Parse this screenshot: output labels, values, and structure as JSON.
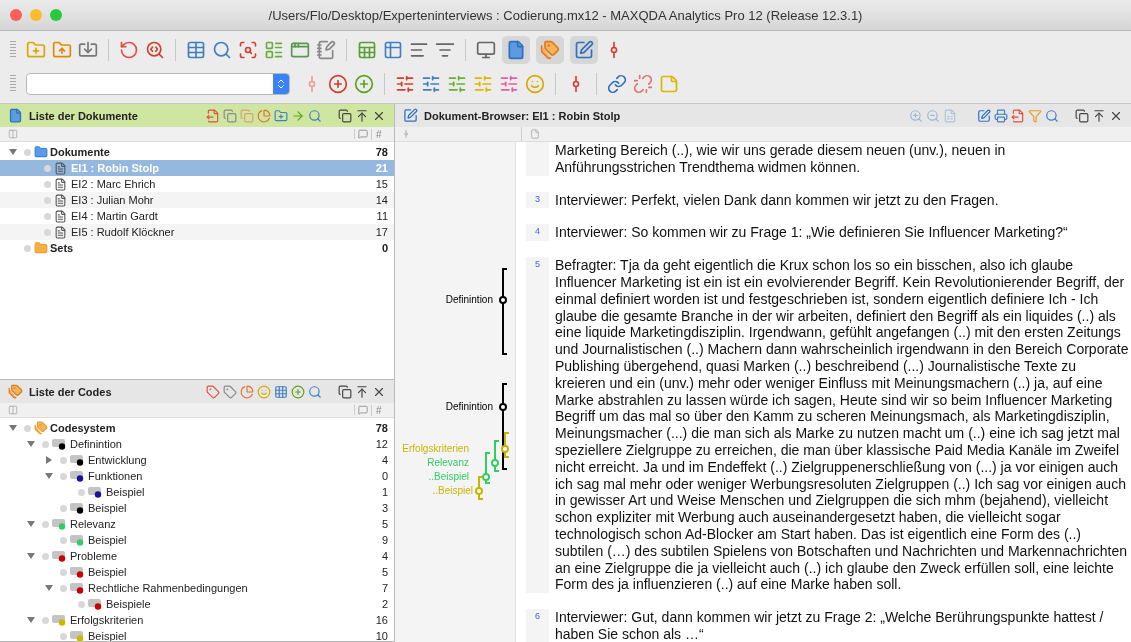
{
  "window": {
    "title": "/Users/Flo/Desktop/Experteninterviews : Codierung.mx12 - MAXQDA Analytics Pro 12  (Release 12.3.1)"
  },
  "toolbar": {
    "view_toggles": [
      {
        "on": true
      },
      {
        "on": true
      },
      {
        "on": true
      }
    ]
  },
  "documents_panel": {
    "title": "Liste der Dokumente",
    "count_column": "#",
    "tree": [
      {
        "label": "Dokumente",
        "count": "78",
        "kind": "folder",
        "expanded": true,
        "selected": false,
        "children": [
          {
            "label": "EI1 : Robin Stolp",
            "count": "21",
            "kind": "doc",
            "selected": true
          },
          {
            "label": "EI2 : Marc Ehrich",
            "count": "15",
            "kind": "doc",
            "selected": false
          },
          {
            "label": "EI3 : Julian Mohr",
            "count": "14",
            "kind": "doc",
            "selected": false
          },
          {
            "label": "EI4 : Martin Gardt",
            "count": "11",
            "kind": "doc",
            "selected": false
          },
          {
            "label": "EI5 : Rudolf Klöckner",
            "count": "17",
            "kind": "doc",
            "selected": false
          }
        ]
      },
      {
        "label": "Sets",
        "count": "0",
        "kind": "set",
        "selected": false
      }
    ]
  },
  "codes_panel": {
    "title": "Liste der Codes",
    "count_column": "#",
    "tree": [
      {
        "label": "Codesystem",
        "count": "78",
        "kind": "root",
        "expanded": true,
        "children": [
          {
            "label": "Definintion",
            "count": "12",
            "color": "#000000",
            "expanded": true,
            "children": [
              {
                "label": "Entwicklung",
                "count": "4",
                "color": "#000000",
                "expanded": false
              },
              {
                "label": "Funktionen",
                "count": "0",
                "color": "#1a0f9e",
                "expanded": true,
                "children": [
                  {
                    "label": "Beispiel",
                    "count": "1",
                    "color": "#1a0f9e"
                  }
                ]
              },
              {
                "label": "Beispiel",
                "count": "3",
                "color": "#000000"
              }
            ]
          },
          {
            "label": "Relevanz",
            "count": "5",
            "color": "#33cc66",
            "expanded": true,
            "children": [
              {
                "label": "Beispiel",
                "count": "9",
                "color": "#33cc66"
              }
            ]
          },
          {
            "label": "Probleme",
            "count": "4",
            "color": "#cc0000",
            "expanded": true,
            "children": [
              {
                "label": "Beispiel",
                "count": "5",
                "color": "#cc0000"
              },
              {
                "label": "Rechtliche Rahmenbedingungen",
                "count": "7",
                "color": "#cc0000",
                "expanded": true,
                "children": [
                  {
                    "label": "Beispiele",
                    "count": "2",
                    "color": "#cc0000"
                  }
                ]
              }
            ]
          },
          {
            "label": "Erfolgskriterien",
            "count": "16",
            "color": "#ccb800",
            "expanded": true,
            "children": [
              {
                "label": "Beispiel",
                "count": "10",
                "color": "#ccb800"
              }
            ]
          }
        ]
      }
    ]
  },
  "browser": {
    "title": "Dokument-Browser: EI1 : Robin Stolp",
    "coding_stripes": [
      {
        "label": "Definintion",
        "color": "#000000"
      },
      {
        "label": "Definintion",
        "color": "#000000"
      },
      {
        "label": "Erfolgskriterien",
        "color": "#c8b400"
      },
      {
        "label": "Relevanz",
        "color": "#33cc66"
      },
      {
        "label": "..Beispiel",
        "color": "#33cc66"
      },
      {
        "label": "..Beispiel",
        "color": "#c8b400"
      }
    ],
    "paragraphs": [
      {
        "text": "Marketing Bereich (..), wie wir uns gerade diesem neuen (unv.), neuen in Anführungsstrichen Trendthema widmen können."
      },
      {
        "number": "3",
        "text": "Interviewer: Perfekt, vielen Dank dann kommen wir jetzt zu den Fragen."
      },
      {
        "number": "4",
        "text": "Interviewer: So kommen wir zu Frage 1: „Wie definieren Sie Influencer Marketing?“"
      },
      {
        "number": "5",
        "text": "Befragter: Tja da geht eigentlich die Krux schon los so ein bisschen, also ich glaube Influencer Marketing ist ein ist ein evolvierender Begriff. Kein Revolutionierender Begriff, der einmal definiert worden ist und festgeschrieben ist, sondern eigentlich definiere Ich - Ich glaube die gesamte Branche in der wir arbeiten, definiert den Begriff als ein liquides (..) als eine liquide Marketingdisziplin. Irgendwann, gefühlt angefangen (..) mit den ersten Zeitungs und Journalistischen (..) Machern dann wahrscheinlich irgendwann in den Bereich Corporate Publishing übergehend, quasi Marken (..) beschreibend (...) Journalistische Texte zu kreieren und ein (unv.) mehr oder weniger Einfluss mit Meinungsmachern (..) ja, auf eine Marke abstrahlen zu lassen würde ich sagen, Heute sind wir so beim Influencer Marketing Begriff um das mal so über den Kamm zu scheren Meinungsmach, als Marketingdisziplin, Meinungsmacher (...) die man sich als Marke zu nutzen macht um (..) eine ich sag jetzt mal speziellere Zielgruppe zu erreichen, die man über klassische Paid Media Kanäle im Zweifel nicht erreicht. Ja und im Endeffekt (..) Zielgruppenerschließung von (...) ja vor einigen auch ich sag mal mehr oder weniger Werbungsresoluten Zielgruppen (..) Ich sag vor einigen auch in gewisser Art und Weise Menschen und Zielgruppen die sich mhm (bejahend), vielleicht schon expliziter mit Werbung auch auseinandergesetzt haben, die vielleicht sogar technologisch schon Ad-Blocker am Start haben. Das ist eigentlich eine Form des (..) subtilen (…) des subtilen Spielens von Botschaften und Nachrichten und Markennachrichten an eine Zielgruppe die ja vielleicht auch (..) ich glaube den Zweck erfüllen soll, eine leichte Form des ja influenzieren (..) auf eine Marke haben soll."
      },
      {
        "number": "6",
        "text": "Interviewer: Gut, dann kommen wir jetzt zu Frage 2: „Welche Berührungspunkte hattest / haben Sie schon als …“"
      }
    ]
  }
}
